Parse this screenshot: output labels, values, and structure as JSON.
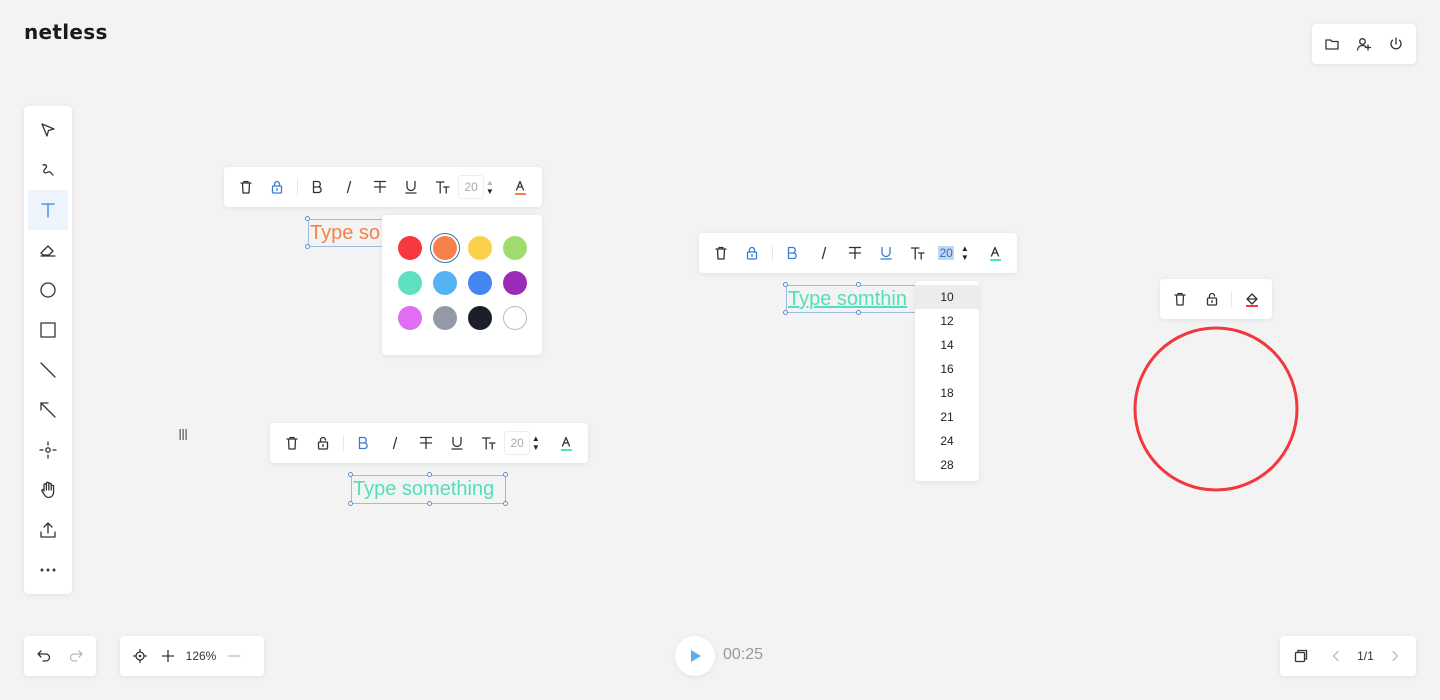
{
  "logo": "netless",
  "left_toolbar": {
    "tools": [
      {
        "name": "selector-tool",
        "icon": "cursor-icon"
      },
      {
        "name": "pencil-tool",
        "icon": "pencil-icon"
      },
      {
        "name": "text-tool",
        "icon": "text-icon",
        "active": true
      },
      {
        "name": "eraser-tool",
        "icon": "eraser-icon"
      },
      {
        "name": "ellipse-tool",
        "icon": "ellipse-icon"
      },
      {
        "name": "rectangle-tool",
        "icon": "rectangle-icon"
      },
      {
        "name": "straight-line-tool",
        "icon": "line-icon"
      },
      {
        "name": "arrow-tool",
        "icon": "arrow-icon"
      },
      {
        "name": "laser-pointer-tool",
        "icon": "laser-icon"
      },
      {
        "name": "hand-tool",
        "icon": "hand-icon"
      },
      {
        "name": "upload-tool",
        "icon": "upload-icon"
      },
      {
        "name": "more-tool",
        "icon": "more-icon"
      }
    ]
  },
  "text_toolbar_1": {
    "size": "20",
    "font_color": "#f6824a"
  },
  "text_toolbar_2": {
    "size": "20",
    "font_color": "#51e0b9"
  },
  "text_toolbar_3": {
    "size": "20",
    "font_color": "#51e0b9"
  },
  "text_boxes": [
    {
      "text": "Type so",
      "color": "#f6824a"
    },
    {
      "text": "Type somthin",
      "color": "#51e0b9"
    },
    {
      "text": "Type something",
      "color": "#51e0b9"
    }
  ],
  "palette": {
    "colors": [
      "#f5393f",
      "#f6824a",
      "#fbd14b",
      "#9fdc6e",
      "#5fe0c0",
      "#55b3f5",
      "#4487f0",
      "#9b2cba",
      "#e06ef2",
      "#939aa6",
      "#1b1f28",
      "#ffffff"
    ],
    "selected": "#f6824a"
  },
  "size_dropdown": {
    "options": [
      "10",
      "12",
      "14",
      "16",
      "18",
      "21",
      "24",
      "28"
    ],
    "highlighted": "10"
  },
  "shape_toolbar": {
    "stroke_color": "#f5393f"
  },
  "circle": {
    "stroke": "#f0383e"
  },
  "zoom": {
    "value": "126%"
  },
  "timer": "00:25",
  "pages": {
    "indicator": "1/1"
  },
  "colors": {
    "accent": "#3381e3",
    "play": "#5aaef0"
  }
}
